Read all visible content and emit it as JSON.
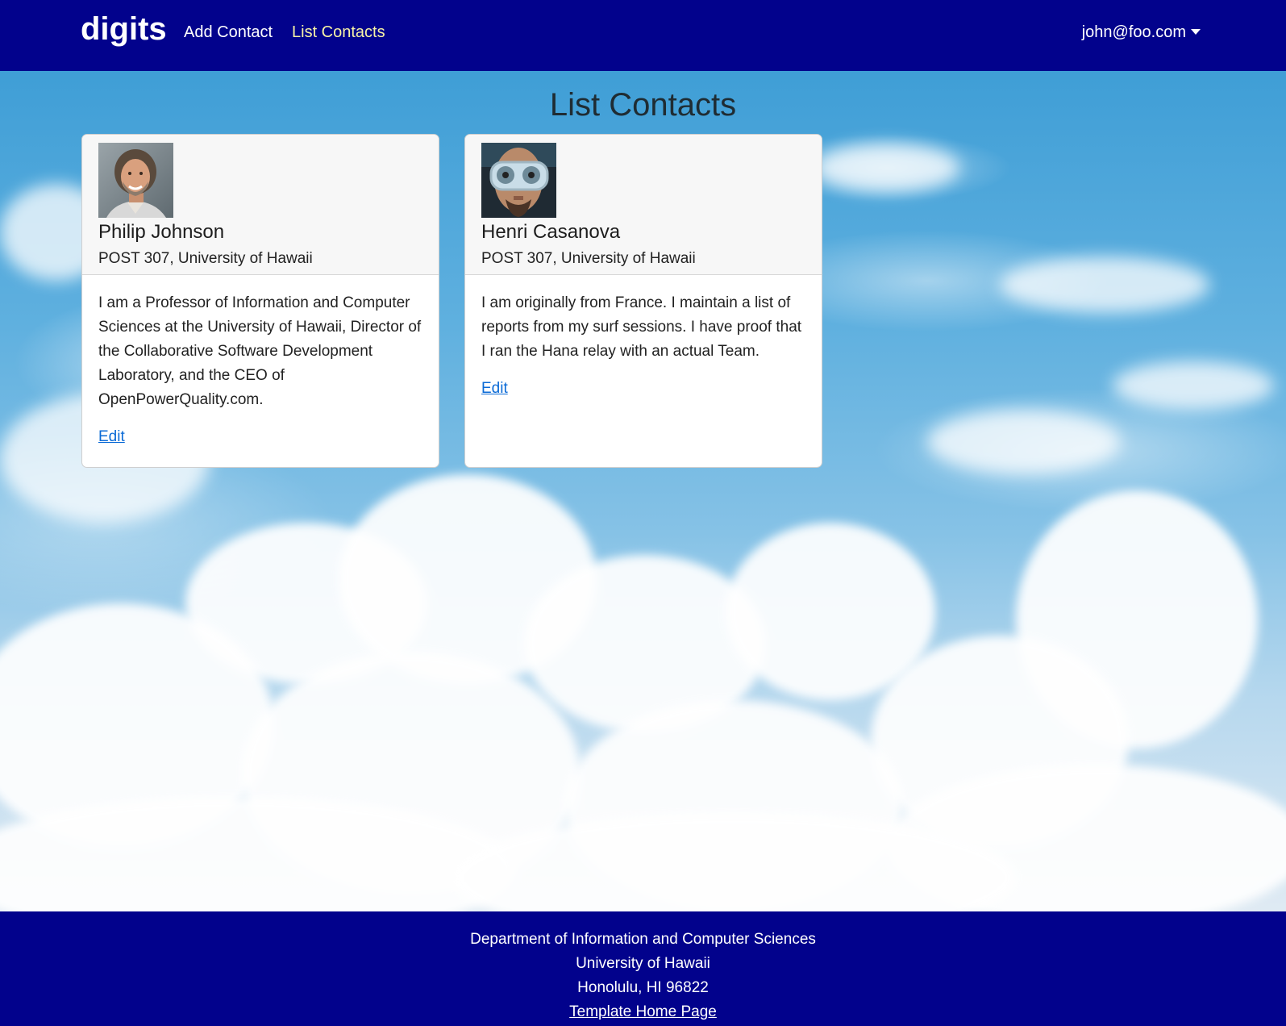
{
  "navbar": {
    "brand": "digits",
    "links": [
      {
        "label": "Add Contact",
        "active": false
      },
      {
        "label": "List Contacts",
        "active": true
      }
    ],
    "user": "john@foo.com",
    "background_color": "#02028c",
    "active_color": "#f7f3a6"
  },
  "main": {
    "title": "List Contacts",
    "contacts": [
      {
        "name": "Philip Johnson",
        "address": "POST 307, University of Hawaii",
        "description": "I am a Professor of Information and Computer Sciences at the University of Hawaii, Director of the Collaborative Software Development Laboratory, and the CEO of OpenPowerQuality.com.",
        "edit_label": "Edit",
        "avatar_icon": "person-photo"
      },
      {
        "name": "Henri Casanova",
        "address": "POST 307, University of Hawaii",
        "description": "I am originally from France. I maintain a list of reports from my surf sessions. I have proof that I ran the Hana relay with an actual Team.",
        "edit_label": "Edit",
        "avatar_icon": "person-photo-goggles"
      }
    ]
  },
  "footer": {
    "line1": "Department of Information and Computer Sciences",
    "line2": "University of Hawaii",
    "line3": "Honolulu, HI 96822",
    "link_label": "Template Home Page"
  },
  "colors": {
    "link": "#0a6ad6",
    "sky": "#5aa5d6"
  }
}
